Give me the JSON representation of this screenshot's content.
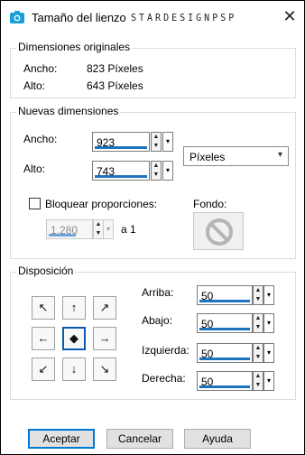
{
  "window": {
    "title": "Tamaño del lienzo",
    "watermark": "STARDESIGNPSP",
    "close_icon": "close-icon"
  },
  "original": {
    "group_label": "Dimensiones originales",
    "width_label": "Ancho:",
    "width_value": "823 Píxeles",
    "height_label": "Alto:",
    "height_value": "643 Píxeles"
  },
  "new_dims": {
    "group_label": "Nuevas dimensiones",
    "width_label": "Ancho:",
    "width_value": "923",
    "height_label": "Alto:",
    "height_value": "743",
    "unit_select": "Píxeles",
    "lock_label": "Bloquear proporciones:",
    "lock_checked": false,
    "ratio_value": "1,280",
    "ratio_suffix": "a 1",
    "fondo_label": "Fondo:"
  },
  "placement": {
    "group_label": "Disposición",
    "arrows": [
      "↖",
      "↑",
      "↗",
      "←",
      "◆",
      "→",
      "↙",
      "↓",
      "↘"
    ],
    "selected_index": 4,
    "top_label": "Arriba:",
    "top_value": "50",
    "bottom_label": "Abajo:",
    "bottom_value": "50",
    "left_label": "Izquierda:",
    "left_value": "50",
    "right_label": "Derecha:",
    "right_value": "50"
  },
  "buttons": {
    "ok": "Aceptar",
    "cancel": "Cancelar",
    "help": "Ayuda"
  },
  "colors": {
    "accent": "#1e73be",
    "default_button_border": "#0078d7"
  }
}
